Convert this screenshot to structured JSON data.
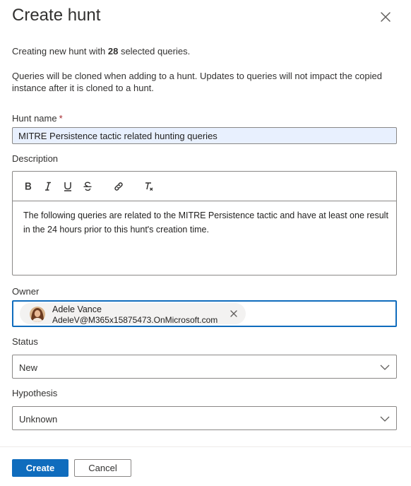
{
  "panel": {
    "title": "Create hunt",
    "close_icon": "close-icon"
  },
  "intro": {
    "prefix": "Creating new hunt with ",
    "count": "28",
    "suffix": " selected queries."
  },
  "note": "Queries will be cloned when adding to a hunt. Updates to queries will not impact the copied instance after it is cloned to a hunt.",
  "hunt_name": {
    "label": "Hunt name",
    "required_mark": "*",
    "value": "MITRE Persistence tactic related hunting queries"
  },
  "description": {
    "label": "Description",
    "toolbar": [
      "bold-icon",
      "italic-icon",
      "underline-icon",
      "strikethrough-icon",
      "link-icon",
      "clear-format-icon"
    ],
    "text": "The following queries are related to the MITRE Persistence tactic and have at least one result in the 24 hours prior to this hunt's creation time."
  },
  "owner": {
    "label": "Owner",
    "name": "Adele Vance",
    "email": "AdeleV@M365x15875473.OnMicrosoft.com"
  },
  "status": {
    "label": "Status",
    "value": "New"
  },
  "hypothesis": {
    "label": "Hypothesis",
    "value": "Unknown"
  },
  "footer": {
    "create_label": "Create",
    "cancel_label": "Cancel"
  },
  "colors": {
    "accent": "#0f6cbd",
    "input_autofill": "#e8f0fe",
    "required": "#a4262c"
  }
}
